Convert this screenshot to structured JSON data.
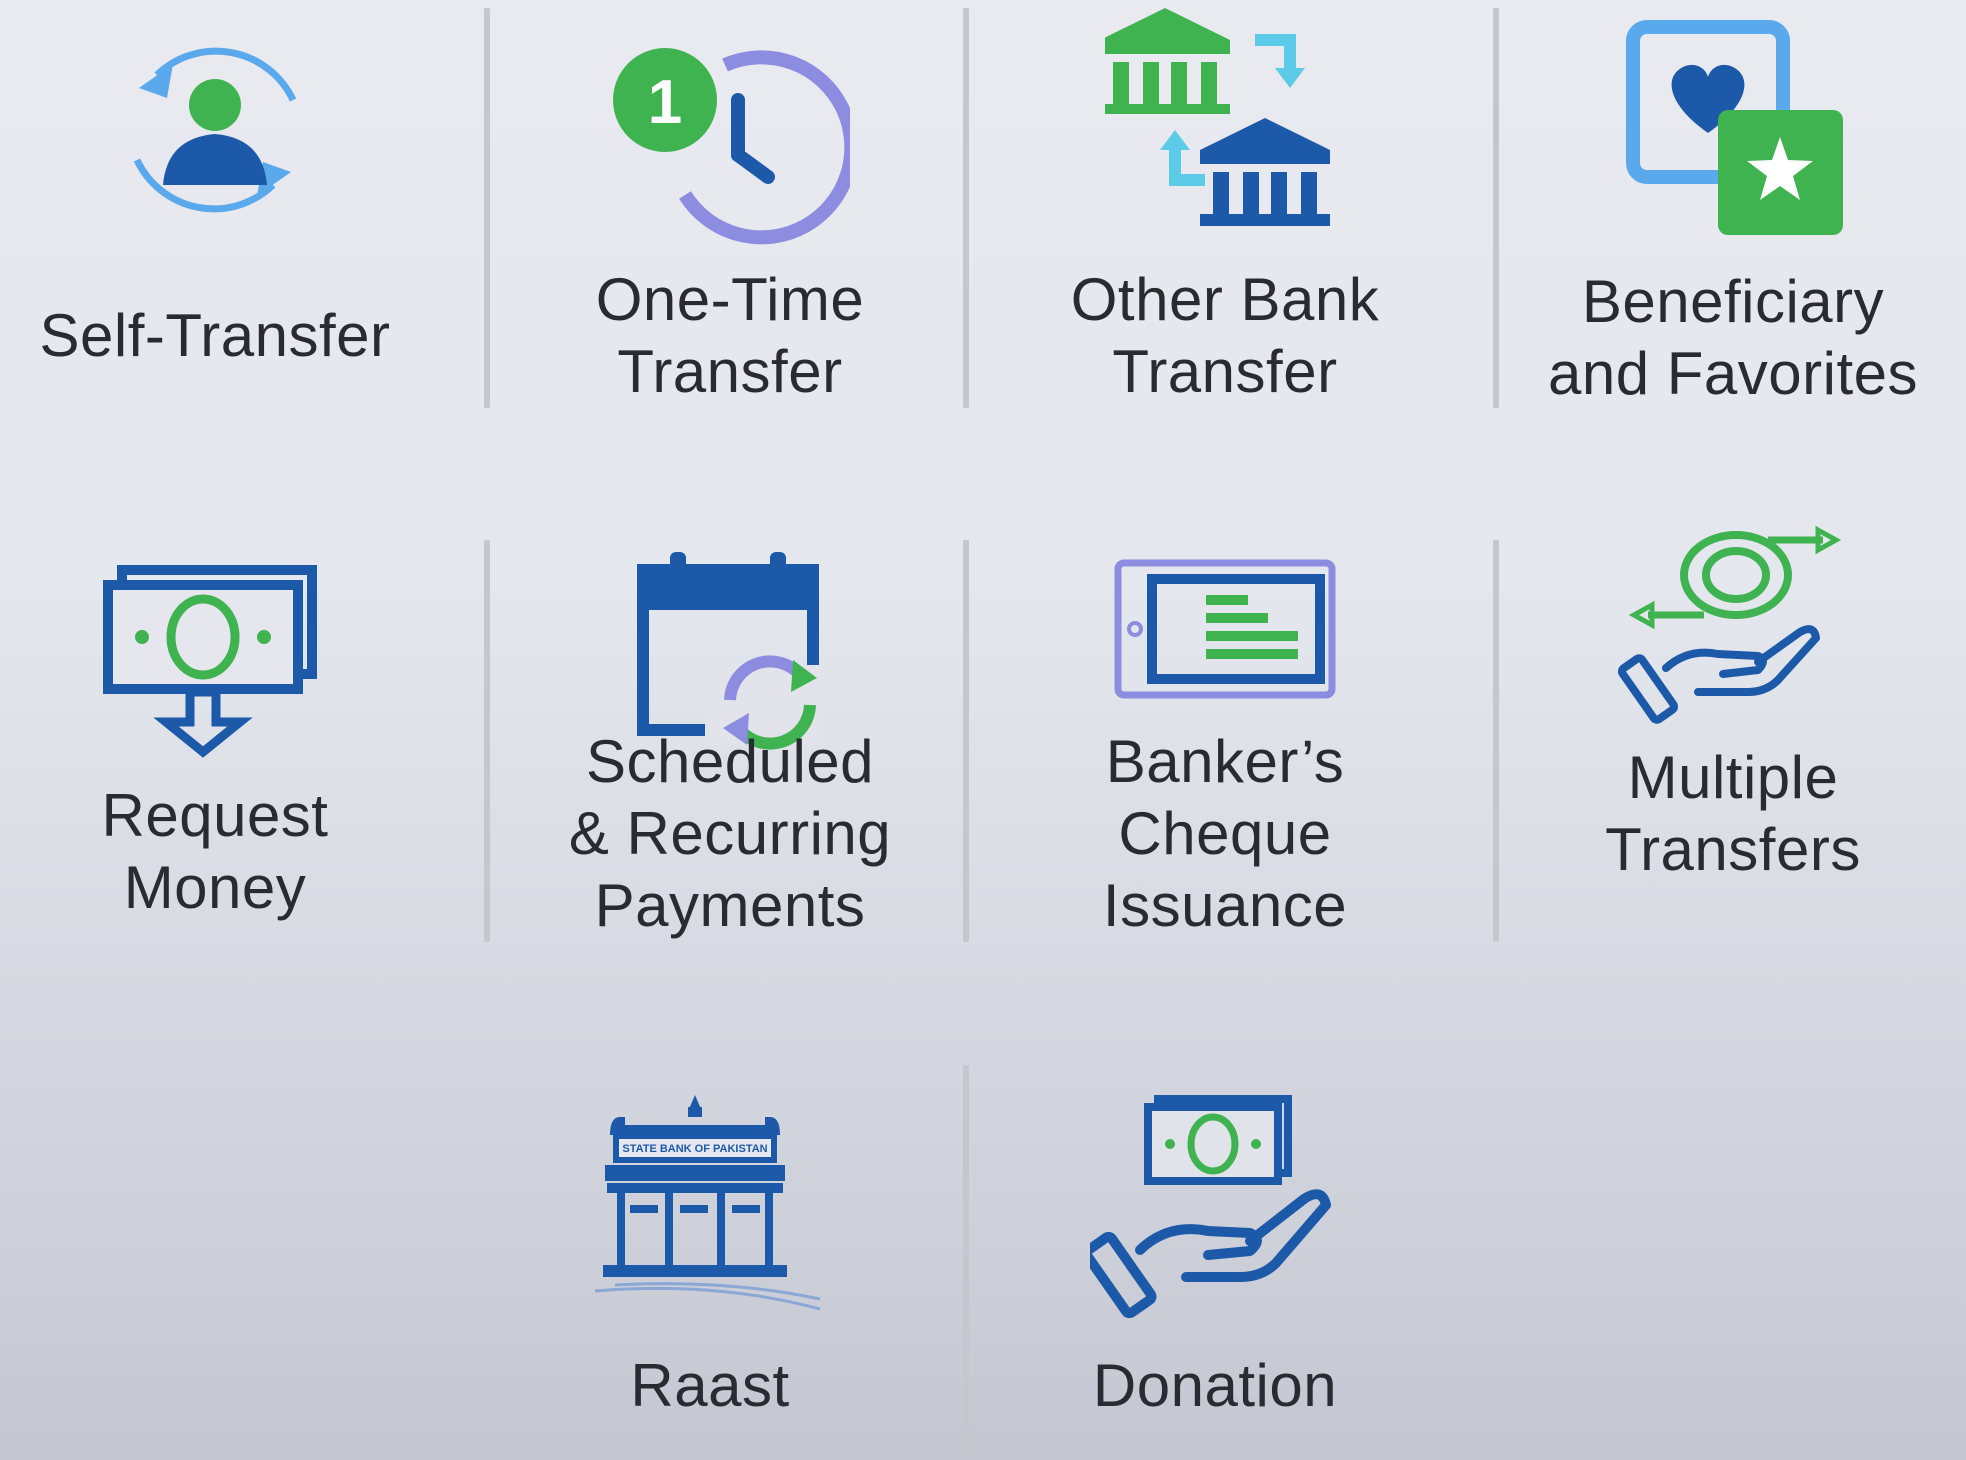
{
  "colors": {
    "blue": "#1c5aa9",
    "green": "#3fb34f",
    "light_blue": "#5aa9ec",
    "purple": "#8c8ce0",
    "text": "#2a2b30",
    "divider": "#c5c7cf"
  },
  "options": [
    {
      "label": "Self-Transfer",
      "icon": "self-transfer-icon"
    },
    {
      "label": "One-Time\nTransfer",
      "icon": "one-time-transfer-icon"
    },
    {
      "label": "Other Bank\nTransfer",
      "icon": "other-bank-transfer-icon"
    },
    {
      "label": "Beneficiary\nand Favorites",
      "icon": "beneficiary-favorites-icon"
    },
    {
      "label": "Request\nMoney",
      "icon": "request-money-icon"
    },
    {
      "label": "Scheduled\n& Recurring\nPayments",
      "icon": "scheduled-payments-icon"
    },
    {
      "label": "Banker’s\nCheque\nIssuance",
      "icon": "bankers-cheque-icon"
    },
    {
      "label": "Multiple\nTransfers",
      "icon": "multiple-transfers-icon"
    },
    {
      "label": "Raast",
      "icon": "raast-icon"
    },
    {
      "label": "Donation",
      "icon": "donation-icon"
    }
  ],
  "icon_text": {
    "one_time_badge": "1",
    "raast_building_sign": "STATE BANK OF PAKISTAN"
  }
}
